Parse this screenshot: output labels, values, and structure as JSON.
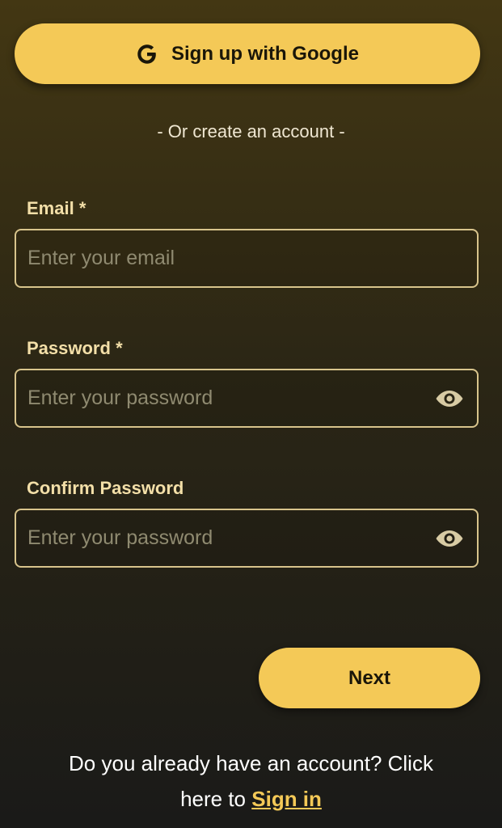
{
  "google_button": {
    "label": "Sign up with Google",
    "icon": "google-g-icon"
  },
  "divider_text": "- Or create an account -",
  "email": {
    "label": "Email",
    "required_mark": "*",
    "placeholder": "Enter your email",
    "value": ""
  },
  "password": {
    "label": "Password",
    "required_mark": "*",
    "placeholder": "Enter your password",
    "value": "",
    "toggle_icon": "eye-icon"
  },
  "confirm_password": {
    "label": "Confirm Password",
    "placeholder": "Enter your password",
    "value": "",
    "toggle_icon": "eye-icon"
  },
  "next_button": {
    "label": "Next"
  },
  "footer": {
    "text_line1": "Do you already have an account? Click",
    "text_line2": "here to",
    "link_label": "Sign in"
  },
  "colors": {
    "accent": "#f4c957",
    "label": "#f3dfa8",
    "border": "#d8c48c"
  }
}
